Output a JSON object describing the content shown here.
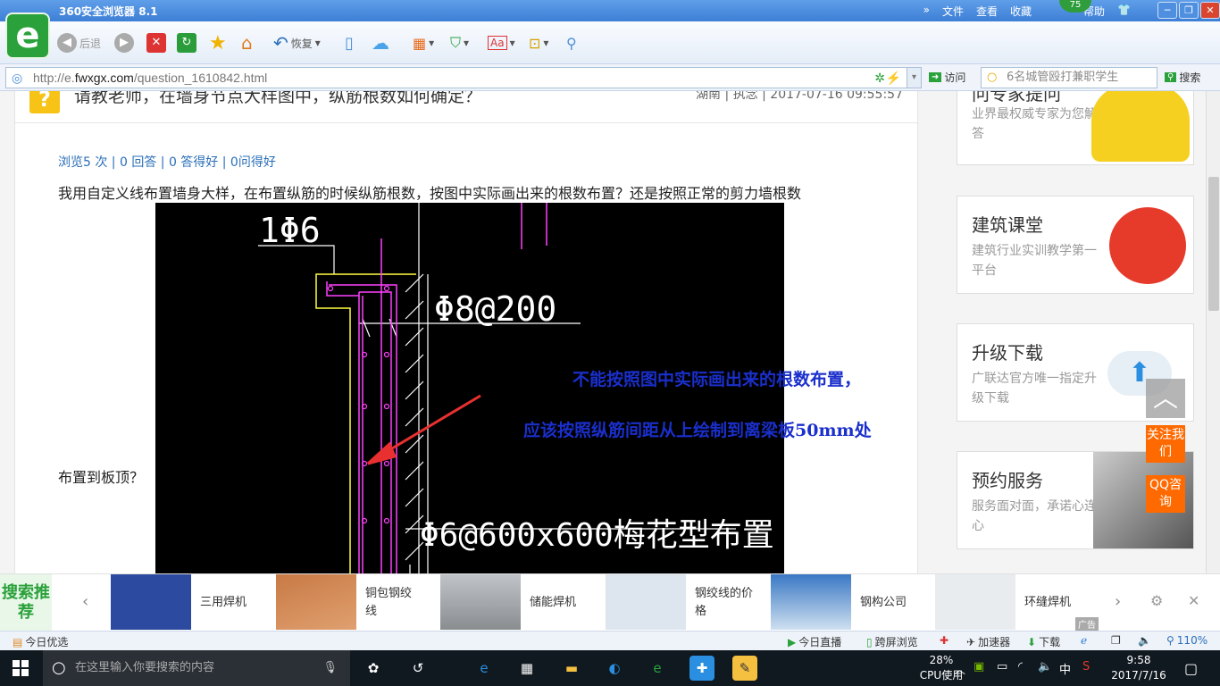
{
  "browser": {
    "title": "360安全浏览器 8.1",
    "menu": [
      "文件",
      "查看",
      "收藏",
      "帮助"
    ],
    "badge": "75",
    "toolbar": {
      "back": "后退",
      "restore": "恢复"
    },
    "url_prefix": "http://e.",
    "url_domain": "fwxgx.com",
    "url_path": "/question_1610842.html",
    "go": "访问",
    "search_value": "6名城管殴打兼职学生",
    "search_button": "搜索"
  },
  "question": {
    "title": "请教老师，在墙身节点大样图中，纵筋根数如何确定？",
    "meta": "湖南 | 执念 | 2017-07-16 09:55:57",
    "stats": "浏览5 次 | 0 回答 | 0 答得好 | 0问得好",
    "body_line1": "我用自定义线布置墙身大样，在布置纵筋的时候纵筋根数，按图中实际画出来的根数布置？还是按照正常的剪力墙根数",
    "body_line2": "布置到板顶？",
    "annotation1": "不能按照图中实际画出来的根数布置，",
    "annotation2": "应该按照纵筋间距从上绘制到离梁板50mm处",
    "cad_labels": {
      "l1": "1Φ6",
      "l2": "Φ8@200",
      "l3": "Φ6@600x600梅花型布置"
    }
  },
  "sidebar": {
    "cards": [
      {
        "title": "问专家提问",
        "sub": "业界最权威专家为您解答"
      },
      {
        "title": "建筑课堂",
        "sub": "建筑行业实训教学第一平台"
      },
      {
        "title": "升级下载",
        "sub": "广联达官方唯一指定升级下载"
      },
      {
        "title": "预约服务",
        "sub": "服务面对面，承诺心连心"
      }
    ],
    "follow": "关注我们",
    "qq": "QQ咨询"
  },
  "recommend": {
    "label": "搜索推荐",
    "items": [
      "三用焊机",
      "铜包钢绞线",
      "储能焊机",
      "钢绞线的价格",
      "钢构公司",
      "环缝焊机"
    ],
    "ad": "广告"
  },
  "statusbar": {
    "left": "今日优选",
    "items": [
      "今日直播",
      "跨屏浏览",
      "加速器",
      "下载"
    ],
    "zoom": "110%"
  },
  "taskbar": {
    "search_placeholder": "在这里输入你要搜索的内容",
    "cpu_pct": "28%",
    "cpu_label": "CPU使用",
    "ime": "中",
    "time": "9:58",
    "date": "2017/7/16"
  }
}
